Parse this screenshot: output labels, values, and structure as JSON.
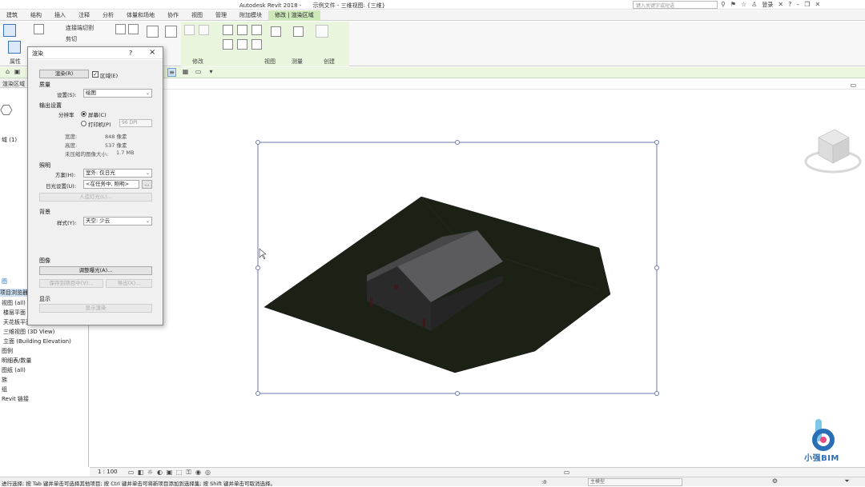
{
  "titlebar": {
    "app": "Autodesk Revit 2018 -",
    "file": "示例文件 - 三维视图: {三维}",
    "search_placeholder": "键入关键字或短语",
    "login": "登录"
  },
  "tabs": [
    "建筑",
    "结构",
    "插入",
    "注释",
    "分析",
    "体量和场地",
    "协作",
    "视图",
    "管理",
    "附加模块",
    "修改 | 渲染区域"
  ],
  "ribbon": {
    "paste_cut_label": "连接端切割",
    "cut_label": "剪切",
    "properties_label": "属性",
    "modify_label": "修改",
    "view_label": "视图",
    "measure_label": "测量",
    "create_label": "创建"
  },
  "left_panel": {
    "header": "渲染区域",
    "breadcrumb": "域 (1)",
    "section_label": "图",
    "tree": [
      {
        "label": "项目浏览器 - 示例",
        "highlight": true
      },
      {
        "label": "视图 (all)",
        "highlight": false
      },
      {
        "label": "楼层平面",
        "highlight": false
      },
      {
        "label": "天花板平面",
        "highlight": false
      },
      {
        "label": "三维视图 (3D View)",
        "highlight": false
      },
      {
        "label": "立面 (Building Elevation)",
        "highlight": false
      },
      {
        "label": "图例",
        "highlight": false
      },
      {
        "label": "明细表/数量",
        "highlight": false
      },
      {
        "label": "图纸 (all)",
        "highlight": false
      },
      {
        "label": "族",
        "highlight": false
      },
      {
        "label": "组",
        "highlight": false
      },
      {
        "label": "Revit 链接",
        "highlight": false
      }
    ]
  },
  "dialog": {
    "title": "渲染",
    "help": "?",
    "close": "×",
    "render_button": "渲染(R)",
    "region_checkbox": "区域(E)",
    "region_checked": true,
    "quality_section": "质量",
    "setting_label": "设置(S):",
    "setting_value": "绘图",
    "output_section": "输出设置",
    "resolution_label": "分辨率",
    "screen_option": "屏幕(C)",
    "printer_option": "打印机(P)",
    "dpi_value": "96 DPI",
    "width_label": "宽度:",
    "width_value": "848 像素",
    "height_label": "高度:",
    "height_value": "537 像素",
    "size_label": "未压缩的图像大小:",
    "size_value": "1.7 MB",
    "lighting_section": "照明",
    "scheme_label": "方案(H):",
    "scheme_value": "室外: 仅日光",
    "sun_label": "日光设置(U):",
    "sun_value": "<在任务中, 照明>",
    "artificial_button": "人造灯光(L)...",
    "background_section": "背景",
    "style_label": "样式(Y):",
    "style_value": "天空: 少云",
    "image_section": "图像",
    "exposure_button": "调整曝光(A)...",
    "save_project_button": "保存到项目中(V)...",
    "export_button": "导出(X)...",
    "display_section": "显示",
    "display_button": "显示渲染"
  },
  "viewbar": {
    "scale": "1 : 100"
  },
  "statusbar": {
    "message": "进行选择; 按 Tab 键并单击可选择其他项目; 按 Ctrl 键并单击可将新项目添加到选择集; 按 Shift 键并单击可取消选择。",
    "zero": ":0",
    "model": "主模型"
  },
  "logo": {
    "text": "小强BIM",
    "color": "#2a6fb5"
  },
  "colors": {
    "ground": "#1b2114",
    "roof": "#5b5b5d",
    "roof_side": "#47474a",
    "wall": "#2a2a2a",
    "context_tab": "#cde9b9"
  }
}
